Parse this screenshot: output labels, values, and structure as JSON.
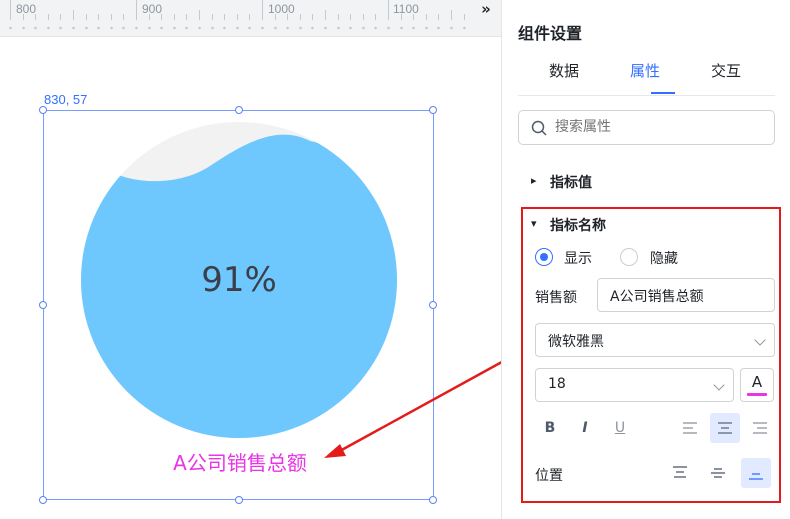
{
  "ruler": {
    "labels": [
      "800",
      "900",
      "1000",
      "1100"
    ],
    "more_icon": "chevron-double-right-icon"
  },
  "canvas": {
    "coordinates": "830, 57",
    "gauge": {
      "value_text": "91%",
      "fill_fraction": 0.91,
      "fill_color": "#6ec8fd",
      "empty_color": "#f2f2f2"
    },
    "indicator_name": "A公司销售总额",
    "indicator_color": "#e935e5"
  },
  "panel": {
    "title": "组件设置",
    "tabs": [
      "数据",
      "属性",
      "交互"
    ],
    "active_tab": "属性",
    "search": {
      "placeholder": "搜索属性",
      "icon": "search-icon"
    },
    "sections": {
      "indicator_value": {
        "label": "指标值",
        "expanded": false
      },
      "indicator_name": {
        "label": "指标名称",
        "expanded": true,
        "visibility": {
          "show_label": "显示",
          "hide_label": "隐藏",
          "selected": "显示"
        },
        "name_field": {
          "label": "销售额",
          "value": "A公司销售总额"
        },
        "font_family": "微软雅黑",
        "font_size": "18",
        "font_color": {
          "letter": "A",
          "color": "#e935e5"
        },
        "style_buttons": {
          "bold": "B",
          "italic": "I",
          "underline": "U"
        },
        "text_align": {
          "selected": "center",
          "options": [
            "left",
            "center",
            "right"
          ]
        },
        "position": {
          "label": "位置",
          "selected": "bottom",
          "options": [
            "top",
            "middle",
            "bottom"
          ]
        }
      }
    }
  },
  "colors": {
    "accent": "#3370ff",
    "highlight_border": "#e41b1b"
  }
}
